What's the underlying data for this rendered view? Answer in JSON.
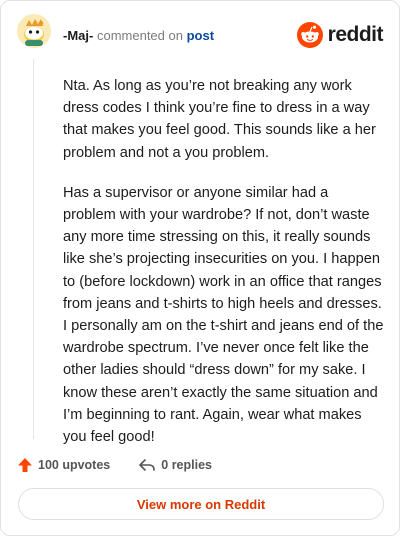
{
  "header": {
    "author": "-Maj-",
    "commented_on": "commented on",
    "post_link": "post",
    "brand": "reddit"
  },
  "comment": {
    "paragraphs": [
      "Nta. As long as you’re not breaking any work dress codes I think you’re fine to dress in a way that makes you feel good. This sounds like a her problem and not a you problem.",
      "Has a supervisor or anyone similar had a problem with your wardrobe? If not, don’t waste any more time stressing on this, it really sounds like she’s projecting insecurities on you. I happen to (before lockdown) work in an office that ranges from jeans and t-shirts to high heels and dresses. I personally am on the t-shirt and jeans end of the wardrobe spectrum. I’ve never once felt like the other ladies should “dress down” for my sake. I know these aren’t exactly the same situation and I’m beginning to rant. Again, wear what makes you feel good!"
    ]
  },
  "footer": {
    "upvotes": "100 upvotes",
    "replies": "0 replies",
    "view_more": "View more on Reddit"
  },
  "colors": {
    "brand_orange": "#ff4500",
    "upvote_orange": "#ff4500",
    "link_blue": "#0a4b9c",
    "view_more_text": "#d93900"
  },
  "icons": [
    "avatar-snoo",
    "reddit-logo-icon",
    "upvote-arrow-icon",
    "reply-arrow-icon"
  ]
}
